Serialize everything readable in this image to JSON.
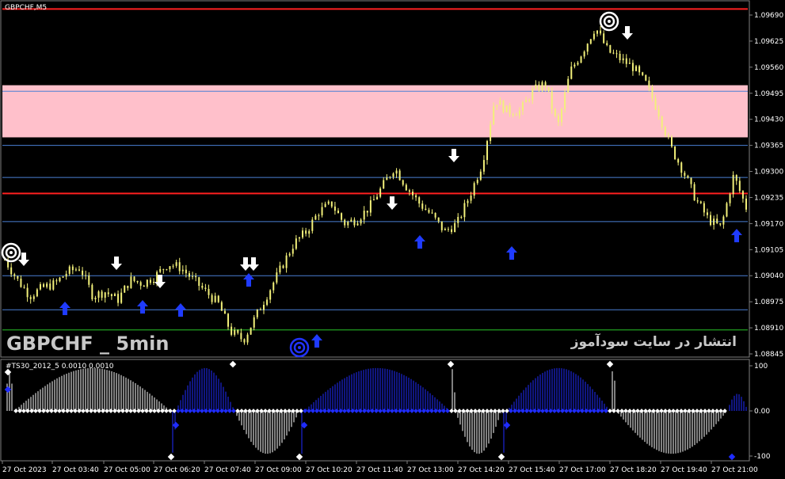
{
  "window": {
    "title": "GBPCHF,M5"
  },
  "overlay": {
    "symbol_caption": "GBPCHF _ 5min",
    "publisher_caption": "انتشار در سایت سودآموز"
  },
  "colors": {
    "background": "#000000",
    "candles": "#f2f07a",
    "zone": "#ffc0cb",
    "red_level": "#ff2020",
    "blue_level": "#4a7fd4",
    "green_level": "#1d8a1d",
    "up_arrow": "#1f3bff",
    "down_arrow": "#ffffff",
    "oscillator_white": "#ffffff",
    "oscillator_blue": "#1f2cff"
  },
  "icons": [
    "arrow-up-icon",
    "arrow-down-icon",
    "target-icon"
  ],
  "chart_data": [
    {
      "type": "candlestick",
      "symbol": "GBPCHF",
      "timeframe": "M5",
      "ylim": [
        1.08845,
        1.097
      ],
      "y_ticks": [
        "1.09690",
        "1.09625",
        "1.09560",
        "1.09495",
        "1.09430",
        "1.09365",
        "1.09300",
        "1.09235",
        "1.09170",
        "1.09105",
        "1.09040",
        "1.08975",
        "1.08910",
        "1.08845"
      ],
      "x_ticks": [
        "27 Oct 2023",
        "27 Oct 03:40",
        "27 Oct 05:00",
        "27 Oct 06:20",
        "27 Oct 07:40",
        "27 Oct 09:00",
        "27 Oct 10:20",
        "27 Oct 11:40",
        "27 Oct 13:00",
        "27 Oct 14:20",
        "27 Oct 15:40",
        "27 Oct 17:00",
        "27 Oct 18:20",
        "27 Oct 19:40",
        "27 Oct 21:00"
      ],
      "price_path": [
        1.0908,
        1.0903,
        1.0899,
        1.0901,
        1.0902,
        1.0905,
        1.0906,
        1.0899,
        1.09,
        1.0898,
        1.0903,
        1.0902,
        1.0904,
        1.0907,
        1.0906,
        1.0903,
        1.09,
        1.0897,
        1.089,
        1.0888,
        1.0894,
        1.09,
        1.0906,
        1.0912,
        1.0915,
        1.092,
        1.0922,
        1.0917,
        1.0918,
        1.0921,
        1.0926,
        1.0931,
        1.0926,
        1.0922,
        1.0919,
        1.0915,
        1.0917,
        1.0924,
        1.0932,
        1.0948,
        1.0945,
        1.0945,
        1.095,
        1.0952,
        1.0941,
        1.0955,
        1.096,
        1.0966,
        1.096,
        1.0958,
        1.0956,
        1.0952,
        1.0945,
        1.0936,
        1.093,
        1.0923,
        1.0918,
        1.0916,
        1.0929,
        1.0921
      ],
      "zone": [
        1.09385,
        1.09515
      ],
      "red_levels": [
        1.09705,
        1.09245
      ],
      "blue_levels": [
        1.095,
        1.09365,
        1.09285,
        1.09175,
        1.0904,
        1.08955
      ],
      "green_level": 1.08905,
      "up_arrows_at": [
        1.0896,
        1.0896,
        1.0896,
        1.0904,
        1.0908,
        1.0893,
        1.0916,
        1.0911,
        1.0918
      ],
      "down_arrows_at": [
        1.0909,
        1.0907,
        1.0905,
        1.0904,
        1.0908,
        1.0908,
        1.0922,
        1.0934,
        1.0965
      ]
    },
    {
      "type": "histogram",
      "title": "#TS30_2012_5 0.0010 0.0010",
      "ylim": [
        -100,
        100
      ],
      "y_ticks": [
        "100",
        "0.00",
        "-100"
      ]
    }
  ]
}
